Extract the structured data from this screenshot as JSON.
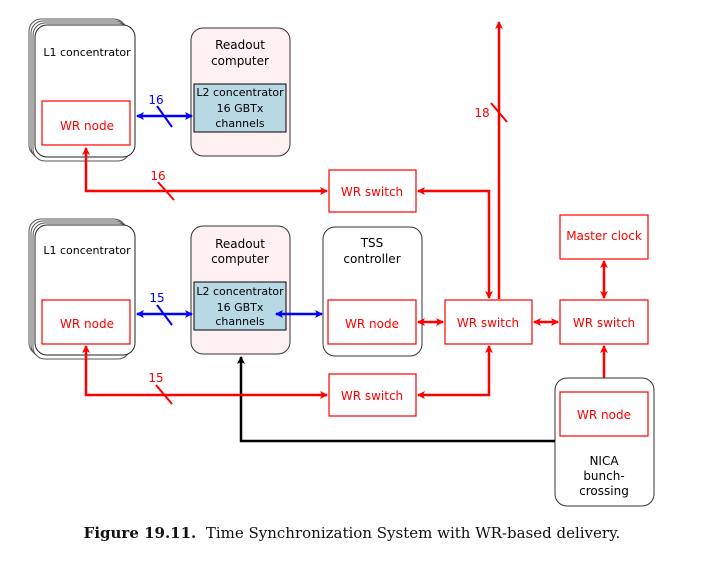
{
  "diagram": {
    "colors": {
      "wr": "#ff0000",
      "blue_link": "#0000ff",
      "black_link": "#000000",
      "readout_fill": "#fff0f2",
      "l2_fill": "#b8d8e4"
    },
    "top_group": {
      "l1_concentrator": {
        "label": "L1 concentrator",
        "wr_node": "WR node"
      },
      "readout_computer": {
        "title_line1": "Readout",
        "title_line2": "computer",
        "l2_line1": "L2 concentrator",
        "l2_line2": "16 GBTx",
        "l2_line3": "channels"
      },
      "blue_link_count": "16",
      "red_link_count": "16",
      "wr_switch": "WR switch"
    },
    "bottom_group": {
      "l1_concentrator": {
        "label": "L1 concentrator",
        "wr_node": "WR node"
      },
      "readout_computer": {
        "title_line1": "Readout",
        "title_line2": "computer",
        "l2_line1": "L2 concentrator",
        "l2_line2": "16 GBTx",
        "l2_line3": "channels"
      },
      "blue_link_count": "15",
      "red_link_count": "15",
      "wr_switch": "WR switch"
    },
    "tss_controller": {
      "title_line1": "TSS",
      "title_line2": "controller",
      "wr_node": "WR node"
    },
    "central_wr_switch": "WR switch",
    "uplink_count": "18",
    "master_clock": "Master clock",
    "master_wr_switch": "WR switch",
    "nica": {
      "wr_node": "WR node",
      "line1": "NICA",
      "line2": "bunch-",
      "line3": "crossing"
    }
  },
  "caption": {
    "label": "Figure 19.11.",
    "text": "Time Synchronization System with WR-based delivery."
  }
}
